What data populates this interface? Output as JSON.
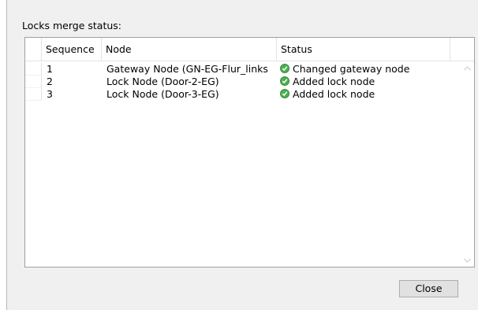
{
  "dialog": {
    "heading": "Locks merge status:",
    "close_label": "Close"
  },
  "grid": {
    "columns": [
      "Sequence",
      "Node",
      "Status"
    ],
    "rows": [
      {
        "sequence": "1",
        "node": "Gateway Node (GN-EG-Flur_links",
        "status": "Changed gateway node",
        "status_icon": "success-check-icon"
      },
      {
        "sequence": "2",
        "node": "Lock Node (Door-2-EG)",
        "status": "Added lock node",
        "status_icon": "success-check-icon"
      },
      {
        "sequence": "3",
        "node": "Lock Node (Door-3-EG)",
        "status": "Added lock node",
        "status_icon": "success-check-icon"
      }
    ]
  },
  "colors": {
    "success": "#4caf50",
    "dialog_bg": "#f0f0f0",
    "button_bg": "#e1e1e1"
  }
}
